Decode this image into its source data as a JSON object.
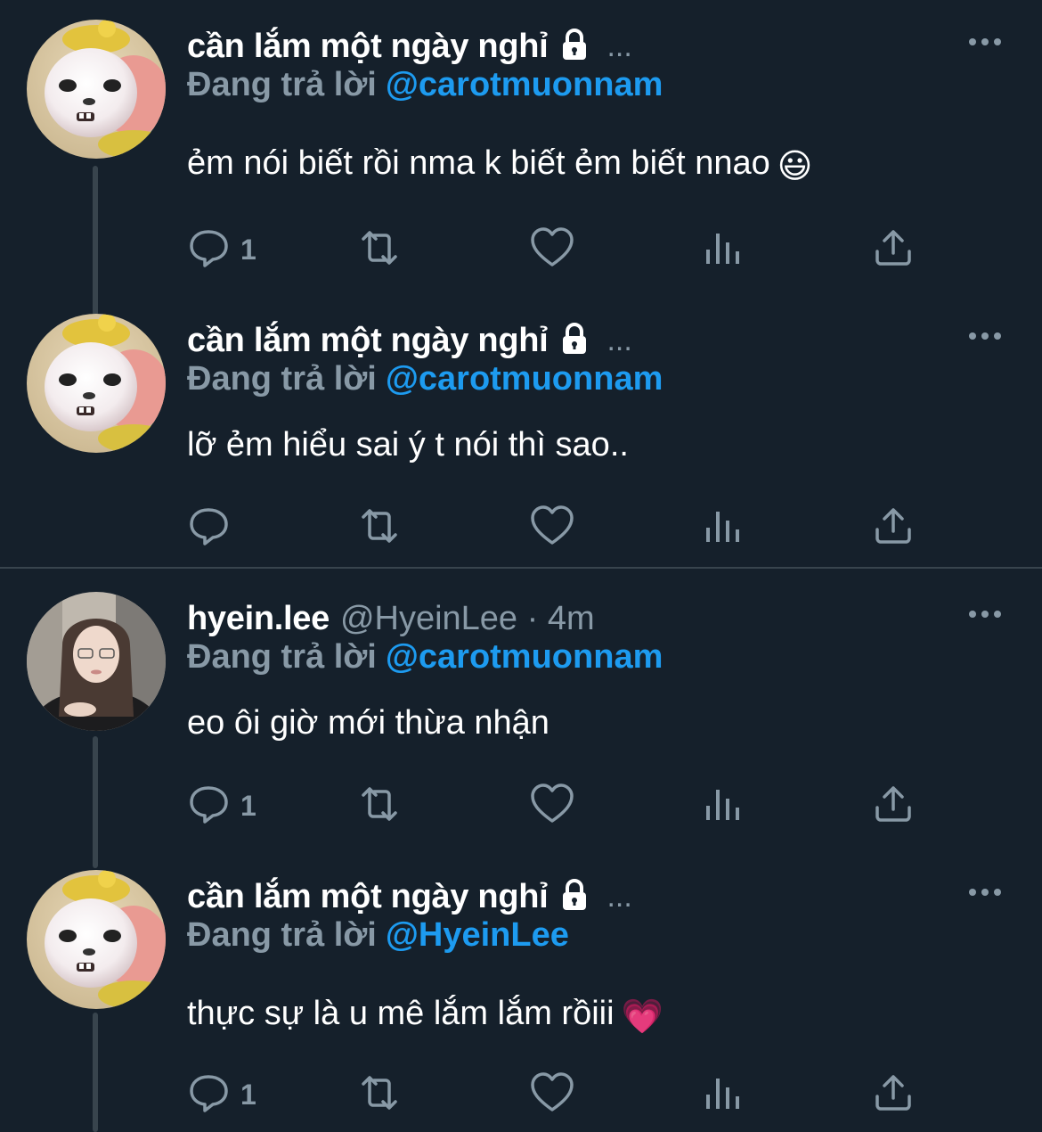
{
  "colors": {
    "background": "#15202b",
    "secondary_text": "#8899a6",
    "accent": "#1d9bf0",
    "divider": "#38444d"
  },
  "icons": {
    "reply": "reply-icon",
    "retweet": "retweet-icon",
    "like": "heart-icon",
    "views": "views-icon",
    "share": "share-icon",
    "lock": "lock-icon",
    "more": "more-icon"
  },
  "tweets": [
    {
      "name": "cần lắm một ngày nghỉ",
      "meta": "...",
      "reply_label": "Đang trả lời",
      "mention": "@carotmuonnam",
      "text": "ẻm nói biết rồi nma k biết ẻm biết nnao",
      "emoji": "😃",
      "reply_count": "1"
    },
    {
      "name": "cần lắm một ngày nghỉ",
      "meta": "...",
      "reply_label": "Đang trả lời",
      "mention": "@carotmuonnam",
      "text": "lỡ ẻm hiểu sai ý t nói thì sao..",
      "reply_count": ""
    },
    {
      "name": "hyein.lee",
      "handle": "@HyeinLee · 4m",
      "reply_label": "Đang trả lời",
      "mention": "@carotmuonnam",
      "text": "eo ôi giờ mới thừa nhận",
      "reply_count": "1"
    },
    {
      "name": "cần lắm một ngày nghỉ",
      "meta": "...",
      "reply_label": "Đang trả lời",
      "mention": "@HyeinLee",
      "text": "thực sự là u mê lắm lắm rồiii",
      "emoji": "💗",
      "reply_count": "1"
    }
  ]
}
